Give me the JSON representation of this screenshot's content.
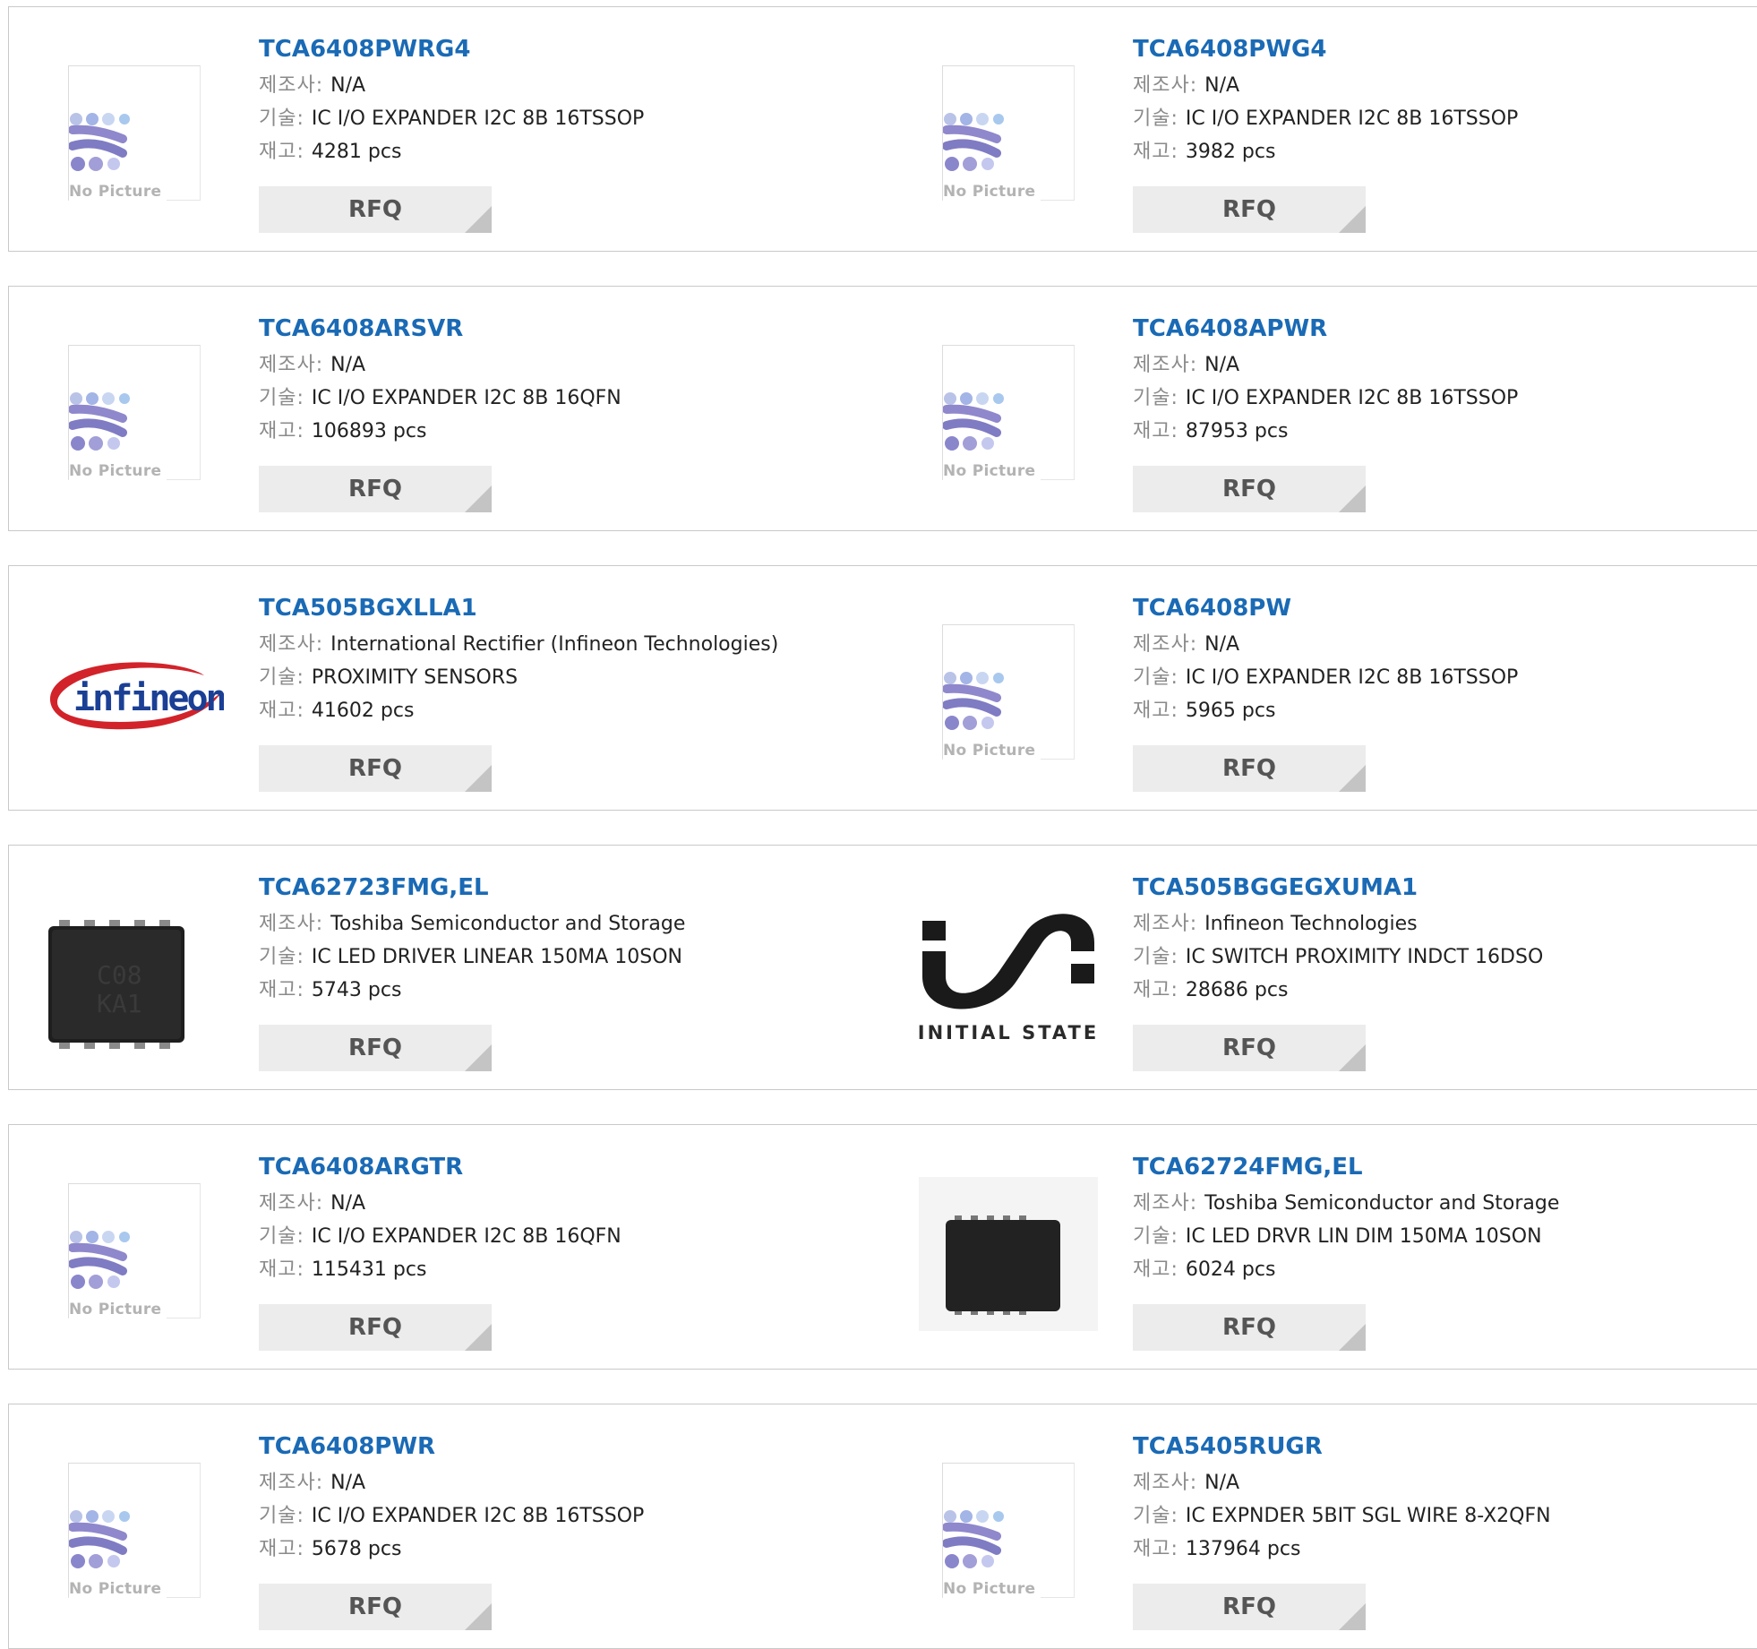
{
  "labels": {
    "manufacturer": "제조사:",
    "description": "기술:",
    "stock": "재고:",
    "rfq": "RFQ",
    "no_picture": "No Picture"
  },
  "colors": {
    "part_link": "#1a6ab5",
    "label": "#8a8a8a",
    "value": "#222222",
    "rfq_bg": "#ececec",
    "border": "#c9c9c9"
  },
  "products": [
    {
      "part": "TCA6408PWRG4",
      "manufacturer": "N/A",
      "description": "IC I/O EXPANDER I2C 8B 16TSSOP",
      "stock": "4281 pcs",
      "image": "no-picture"
    },
    {
      "part": "TCA6408PWG4",
      "manufacturer": "N/A",
      "description": "IC I/O EXPANDER I2C 8B 16TSSOP",
      "stock": "3982 pcs",
      "image": "no-picture"
    },
    {
      "part": "TCA6408ARSVR",
      "manufacturer": "N/A",
      "description": "IC I/O EXPANDER I2C 8B 16QFN",
      "stock": "106893 pcs",
      "image": "no-picture"
    },
    {
      "part": "TCA6408APWR",
      "manufacturer": "N/A",
      "description": "IC I/O EXPANDER I2C 8B 16TSSOP",
      "stock": "87953 pcs",
      "image": "no-picture"
    },
    {
      "part": "TCA505BGXLLA1",
      "manufacturer": "International Rectifier (Infineon Technologies)",
      "description": "PROXIMITY SENSORS",
      "stock": "41602 pcs",
      "image": "infineon-logo",
      "logo_text": "infineon"
    },
    {
      "part": "TCA6408PW",
      "manufacturer": "N/A",
      "description": "IC I/O EXPANDER I2C 8B 16TSSOP",
      "stock": "5965 pcs",
      "image": "no-picture"
    },
    {
      "part": "TCA62723FMG,EL",
      "manufacturer": "Toshiba Semiconductor and Storage",
      "description": "IC LED DRIVER LINEAR 150MA 10SON",
      "stock": "5743 pcs",
      "image": "chip-photo",
      "chip_marking": [
        "C08",
        "KA1"
      ]
    },
    {
      "part": "TCA505BGGEGXUMA1",
      "manufacturer": "Infineon Technologies",
      "description": "IC SWITCH PROXIMITY INDCT 16DSO",
      "stock": "28686 pcs",
      "image": "initial-state-logo",
      "logo_text": "INITIAL STATE"
    },
    {
      "part": "TCA6408ARGTR",
      "manufacturer": "N/A",
      "description": "IC I/O EXPANDER I2C 8B 16QFN",
      "stock": "115431 pcs",
      "image": "no-picture"
    },
    {
      "part": "TCA62724FMG,EL",
      "manufacturer": "Toshiba Semiconductor and Storage",
      "description": "IC LED DRVR LIN DIM 150MA 10SON",
      "stock": "6024 pcs",
      "image": "chip-photo-small"
    },
    {
      "part": "TCA6408PWR",
      "manufacturer": "N/A",
      "description": "IC I/O EXPANDER I2C 8B 16TSSOP",
      "stock": "5678 pcs",
      "image": "no-picture"
    },
    {
      "part": "TCA5405RUGR",
      "manufacturer": "N/A",
      "description": "IC EXPNDER 5BIT SGL WIRE 8-X2QFN",
      "stock": "137964 pcs",
      "image": "no-picture"
    }
  ]
}
